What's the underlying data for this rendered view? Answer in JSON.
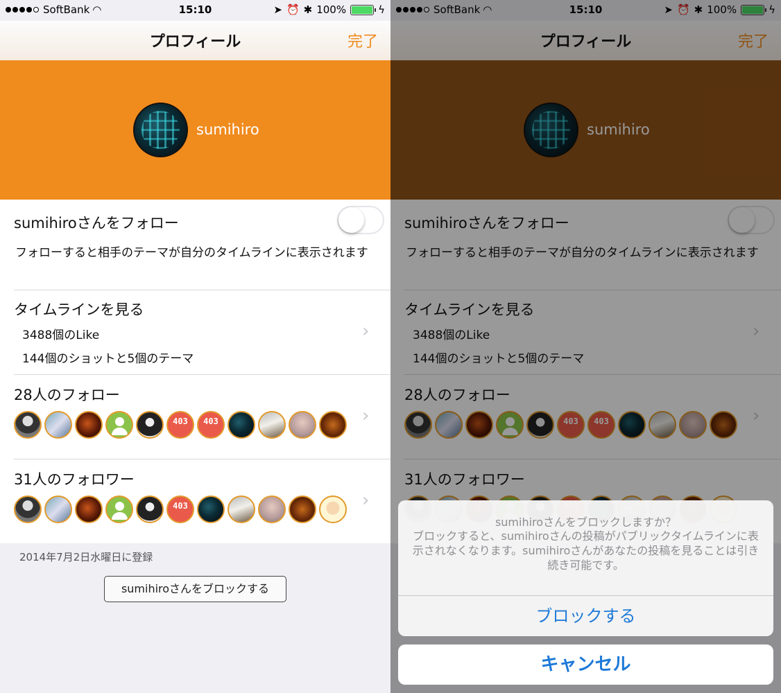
{
  "status_bar": {
    "carrier": "SoftBank",
    "time": "15:10",
    "battery": "100%"
  },
  "nav": {
    "title": "プロフィール",
    "done_label": "完了"
  },
  "colors": {
    "accent": "#f08b1e",
    "accent_dimmed": "#925419",
    "ios_blue": "#1e7ad8"
  },
  "profile": {
    "username": "sumihiro"
  },
  "follow": {
    "label": "sumihiroさんをフォロー",
    "enabled": false,
    "description": "フォローすると相手のテーマが自分のタイムラインに表示されます"
  },
  "timeline": {
    "title": "タイムラインを見る",
    "likes": "3488個のLike",
    "shots": "144個のショットと5個のテーマ"
  },
  "following": {
    "title": "28人のフォロー",
    "avatars": [
      "person-photo",
      "person-photo",
      "dark-red-photo",
      "default-user-icon",
      "person-photo",
      "403-icon",
      "403-icon",
      "sphere-logo",
      "dog-photo",
      "blurred-photo",
      "food-photo"
    ]
  },
  "followers": {
    "title": "31人のフォロワー",
    "avatars": [
      "person-photo",
      "person-photo",
      "dark-red-photo",
      "default-user-icon",
      "person-photo",
      "403-icon",
      "sphere-logo",
      "dog-photo",
      "blurred-photo",
      "food-photo",
      "cartoon-face"
    ]
  },
  "footer": {
    "registered": "2014年7月2日水曜日に登録",
    "block_button": "sumihiroさんをブロックする"
  },
  "action_sheet": {
    "title": "sumihiroさんをブロックしますか？",
    "message": "ブロックすると、sumihiroさんの投稿がパブリックタイムラインに表示されなくなります。sumihiroさんがあなたの投稿を見ることは引き続き可能です。",
    "confirm": "ブロックする",
    "cancel": "キャンセル"
  },
  "icons": {
    "chevron": "›",
    "avatar_403_text": "403"
  }
}
